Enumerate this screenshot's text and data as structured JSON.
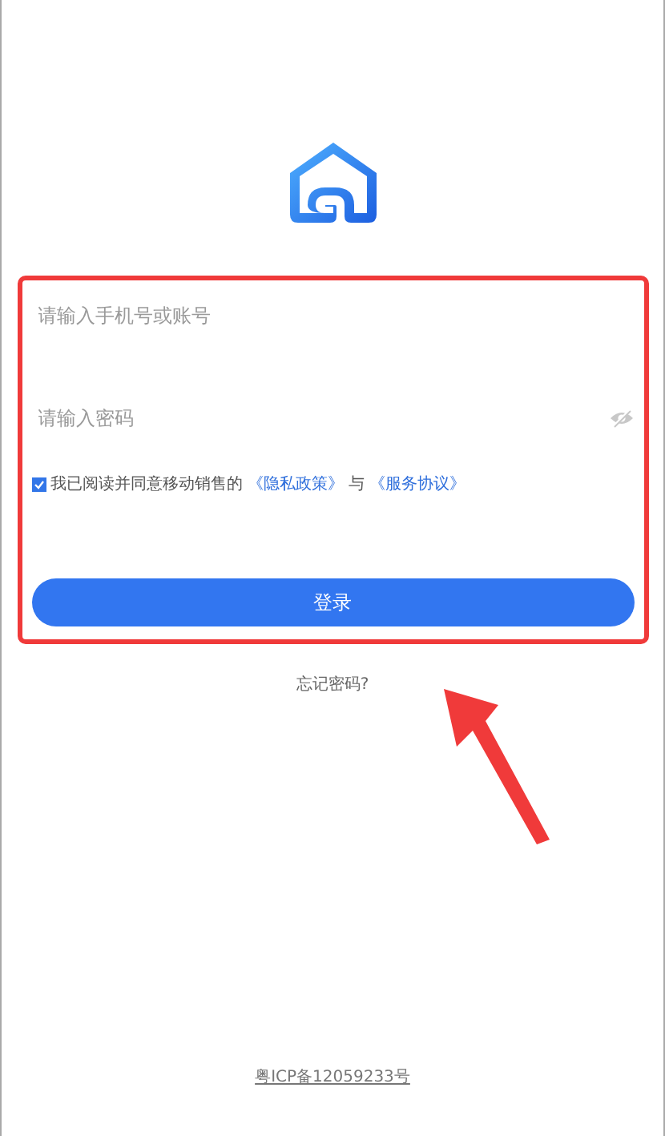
{
  "login_form": {
    "account_field": {
      "placeholder": "请输入手机号或账号"
    },
    "password_field": {
      "placeholder": "请输入密码"
    },
    "consent": {
      "checked": true,
      "text": "我已阅读并同意移动销售的",
      "privacy_link": "《隐私政策》",
      "joiner": "与",
      "terms_link": "《服务协议》"
    },
    "login_button": "登录"
  },
  "forgot_password": "忘记密码?",
  "footer": {
    "icp": "粤ICP备12059233号"
  },
  "annotation": {
    "highlight": true,
    "arrow": true
  }
}
